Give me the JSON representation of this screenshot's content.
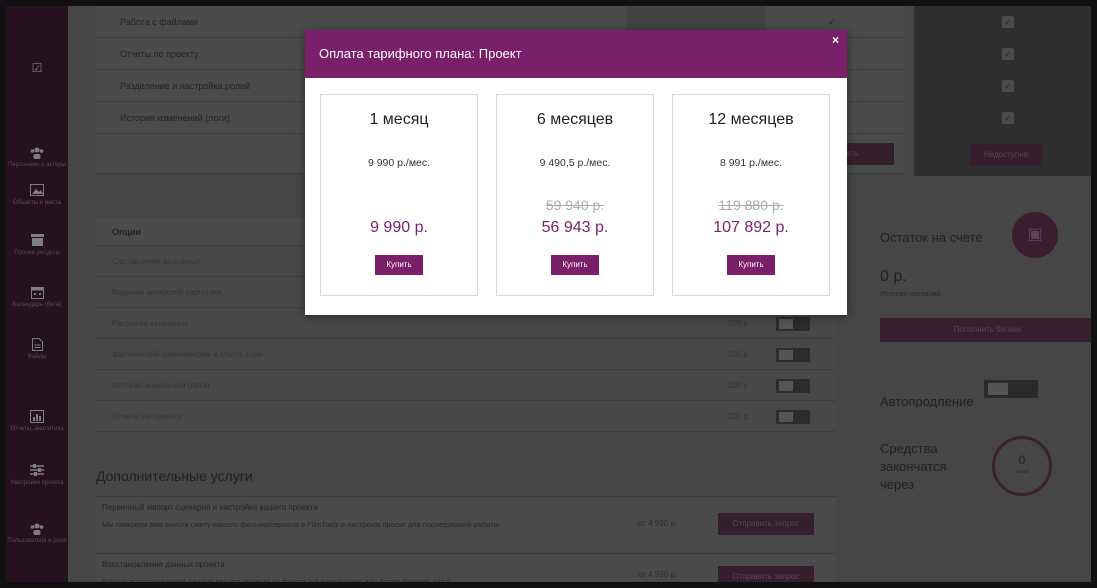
{
  "sidebar": {
    "items": [
      {
        "icon": "users-icon",
        "label": "Персонажи и актеры"
      },
      {
        "icon": "image-icon",
        "label": "Объекты и места"
      },
      {
        "icon": "box-icon",
        "label": "Прочие ресурсы"
      },
      {
        "icon": "calendar-icon",
        "label": "Календарь (бета)"
      },
      {
        "icon": "file-icon",
        "label": "Файлы"
      },
      {
        "icon": "chart-icon",
        "label": "Отчеты, аналитика"
      },
      {
        "icon": "sliders-icon",
        "label": "Настройки проекта"
      },
      {
        "icon": "users-icon",
        "label": "Пользователи и роли"
      }
    ]
  },
  "features": {
    "rows": [
      "Работа с файлами",
      "Отчеты по проекту",
      "Разделение и настройка ролей",
      "История изменений (логи)"
    ],
    "btn_left": "ать",
    "btn_right": "Недоступно"
  },
  "options": {
    "header": "Опции",
    "rows": [
      {
        "label": "Составление вызывных",
        "price": ""
      },
      {
        "label": "Ведение актерской картотеки",
        "price": ""
      },
      {
        "label": "Рассылка вызывных",
        "price": "100 р."
      },
      {
        "label": "Фактический хронометраж и статус сцен",
        "price": "100 р."
      },
      {
        "label": "История изменений (логи)",
        "price": "100 р."
      },
      {
        "label": "Отчеты по проекту",
        "price": "100 р."
      }
    ]
  },
  "account": {
    "balance_title": "Остаток на счете",
    "balance": "0 р.",
    "history_link": "История операций",
    "topup_label": "Пополнить баланс",
    "autorenew_label": "Автопродление",
    "funds_label": "Средства закончатся через",
    "funds_value": "0",
    "funds_unit": "часов"
  },
  "extra": {
    "title": "Дополнительные услуги",
    "services": [
      {
        "title": "Первичный импорт сценария и настройка вашего проекта",
        "desc": "Мы поможем вам внести смету вашего фильма/сериала в FilmToolz и настроим проект для последующей работы",
        "price": "от 4 990 р.",
        "button": "Отправить запрос"
      },
      {
        "title": "Восстановление данных проекта",
        "desc": "Ручное восстановление данных вашего проекта из бэкапа (на вчерашнюю или более раннюю дату)",
        "price": "от 4 990 р.",
        "button": "Отправить запрос"
      }
    ]
  },
  "modal": {
    "title": "Оплата тарифного плана: Проект",
    "close": "×",
    "plans": [
      {
        "title": "1 месяц",
        "per_month": "9 990 р./мес.",
        "old_price": "",
        "total": "9 990 р.",
        "buy": "Купить"
      },
      {
        "title": "6 месяцев",
        "per_month": "9 490,5 р./мес.",
        "old_price": "59 940 р.",
        "total": "56 943 р.",
        "buy": "Купить"
      },
      {
        "title": "12 месяцев",
        "per_month": "8 991 р./мес.",
        "old_price": "119 880 р.",
        "total": "107 892 р.",
        "buy": "Купить"
      }
    ]
  },
  "colors": {
    "accent": "#7a1f69",
    "overlay": "#464646"
  }
}
